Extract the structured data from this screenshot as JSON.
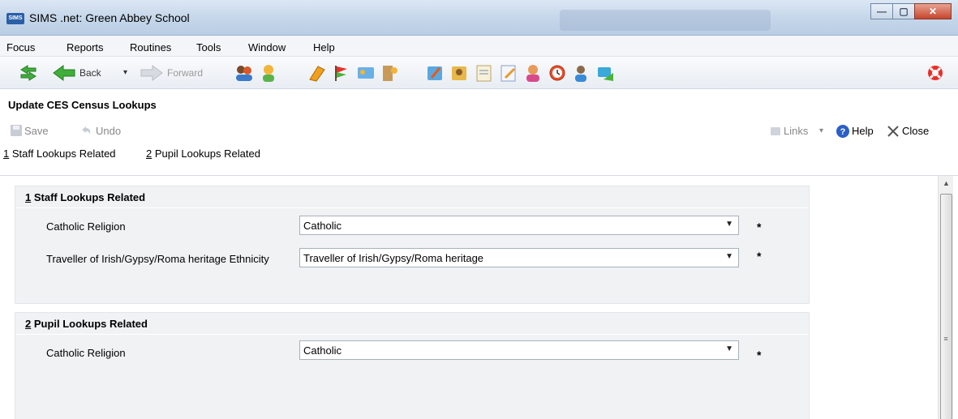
{
  "window": {
    "title": "SIMS .net: Green Abbey School",
    "app_icon_label": "SIMS",
    "controls": {
      "minimize": "—",
      "maximize": "▢",
      "close": "✕"
    }
  },
  "menu": [
    "Focus",
    "Reports",
    "Routines",
    "Tools",
    "Window",
    "Help"
  ],
  "toolbar": {
    "back_label": "Back",
    "forward_label": "Forward",
    "back_dropdown": "▾"
  },
  "page": {
    "title": "Update CES Census Lookups",
    "save_label": "Save",
    "undo_label": "Undo",
    "links_label": "Links",
    "links_dropdown": "▾",
    "help_label": "Help",
    "close_label": "Close",
    "section_links": [
      {
        "num": "1",
        "text": " Staff Lookups Related"
      },
      {
        "num": "2",
        "text": " Pupil Lookups Related"
      }
    ]
  },
  "sections": [
    {
      "num": "1",
      "title": " Staff Lookups Related",
      "rows": [
        {
          "label": "Catholic Religion",
          "value": "Catholic",
          "required": "*"
        },
        {
          "label": "Traveller of Irish/Gypsy/Roma heritage Ethnicity",
          "value": "Traveller of Irish/Gypsy/Roma heritage",
          "required": "*"
        }
      ]
    },
    {
      "num": "2",
      "title": " Pupil Lookups Related",
      "rows": [
        {
          "label": "Catholic Religion",
          "value": "Catholic",
          "required": "*"
        }
      ]
    }
  ],
  "colors": {
    "titlebar": "#c6d7ea",
    "panel_bg": "#f1f2f4",
    "help_blue": "#2b5fc8"
  }
}
